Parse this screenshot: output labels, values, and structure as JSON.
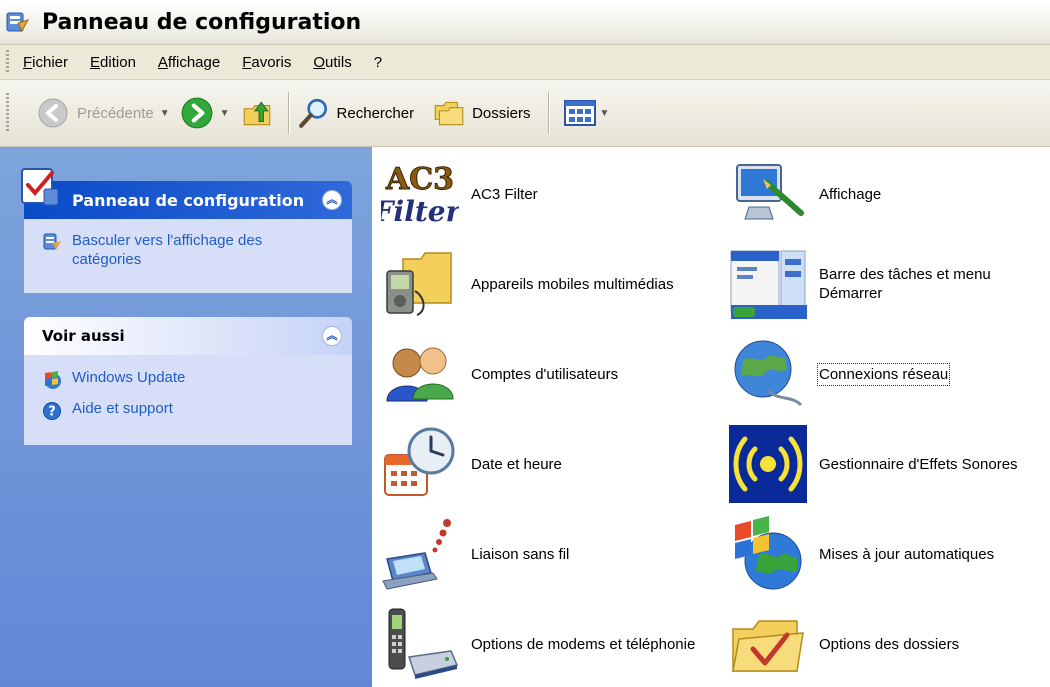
{
  "window": {
    "title": "Panneau de configuration",
    "icon": "control-panel-icon"
  },
  "menu": [
    "Fichier",
    "Edition",
    "Affichage",
    "Favoris",
    "Outils",
    "?"
  ],
  "toolbar": {
    "back_label": "Précédente",
    "search_label": "Rechercher",
    "folders_label": "Dossiers"
  },
  "sidebar": {
    "panel1": {
      "title": "Panneau de configuration",
      "links": [
        {
          "label": "Basculer vers l'affichage des catégories",
          "icon": "switch-view-icon"
        }
      ]
    },
    "panel2": {
      "title": "Voir aussi",
      "links": [
        {
          "label": "Windows Update",
          "icon": "windows-update-icon"
        },
        {
          "label": "Aide et support",
          "icon": "help-icon"
        }
      ]
    }
  },
  "items": [
    {
      "label": "AC3 Filter",
      "icon": "ac3-filter-icon"
    },
    {
      "label": "Affichage",
      "icon": "display-icon"
    },
    {
      "label": "Appareils mobiles multimédias",
      "icon": "mobile-devices-icon"
    },
    {
      "label": "Barre des tâches et menu Démarrer",
      "icon": "taskbar-icon"
    },
    {
      "label": "Comptes d'utilisateurs",
      "icon": "user-accounts-icon"
    },
    {
      "label": "Connexions réseau",
      "icon": "network-connections-icon"
    },
    {
      "label": "Date et heure",
      "icon": "date-time-icon"
    },
    {
      "label": "Gestionnaire d'Effets Sonores",
      "icon": "sound-effects-icon"
    },
    {
      "label": "Liaison sans fil",
      "icon": "wireless-icon"
    },
    {
      "label": "Mises à jour automatiques",
      "icon": "automatic-updates-icon"
    },
    {
      "label": "Options de modems et téléphonie",
      "icon": "modem-phone-icon"
    },
    {
      "label": "Options des dossiers",
      "icon": "folder-options-icon"
    }
  ]
}
